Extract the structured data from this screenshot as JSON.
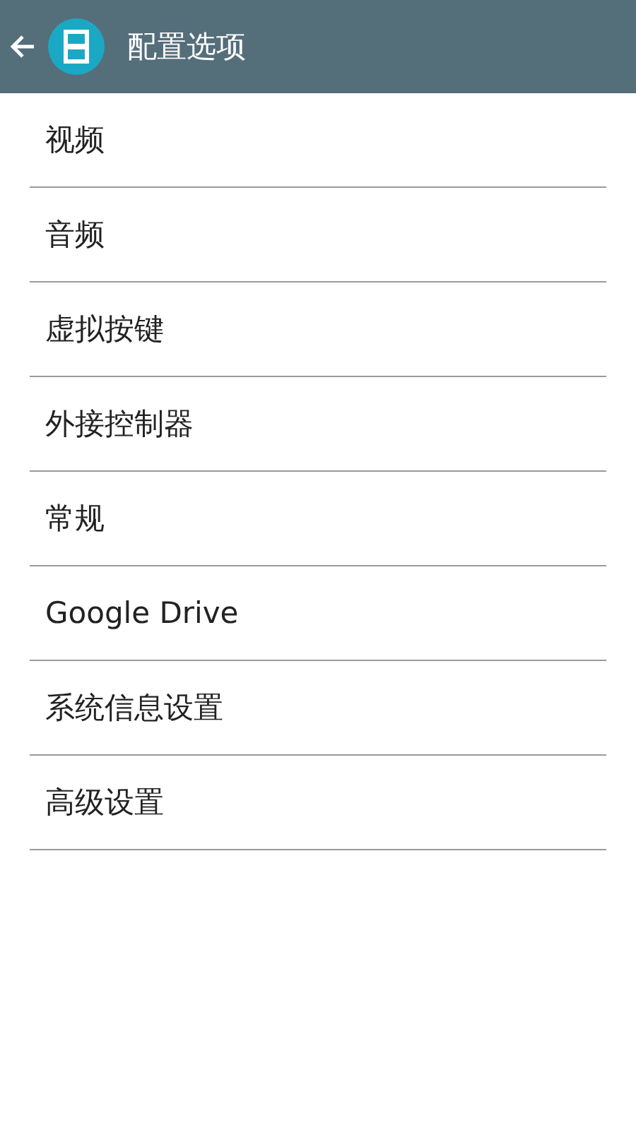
{
  "app_bar": {
    "title": "配置选项"
  },
  "menu_items": [
    "视频",
    "音频",
    "虚拟按键",
    "外接控制器",
    "常规",
    "Google Drive",
    "系统信息设置",
    "高级设置"
  ]
}
